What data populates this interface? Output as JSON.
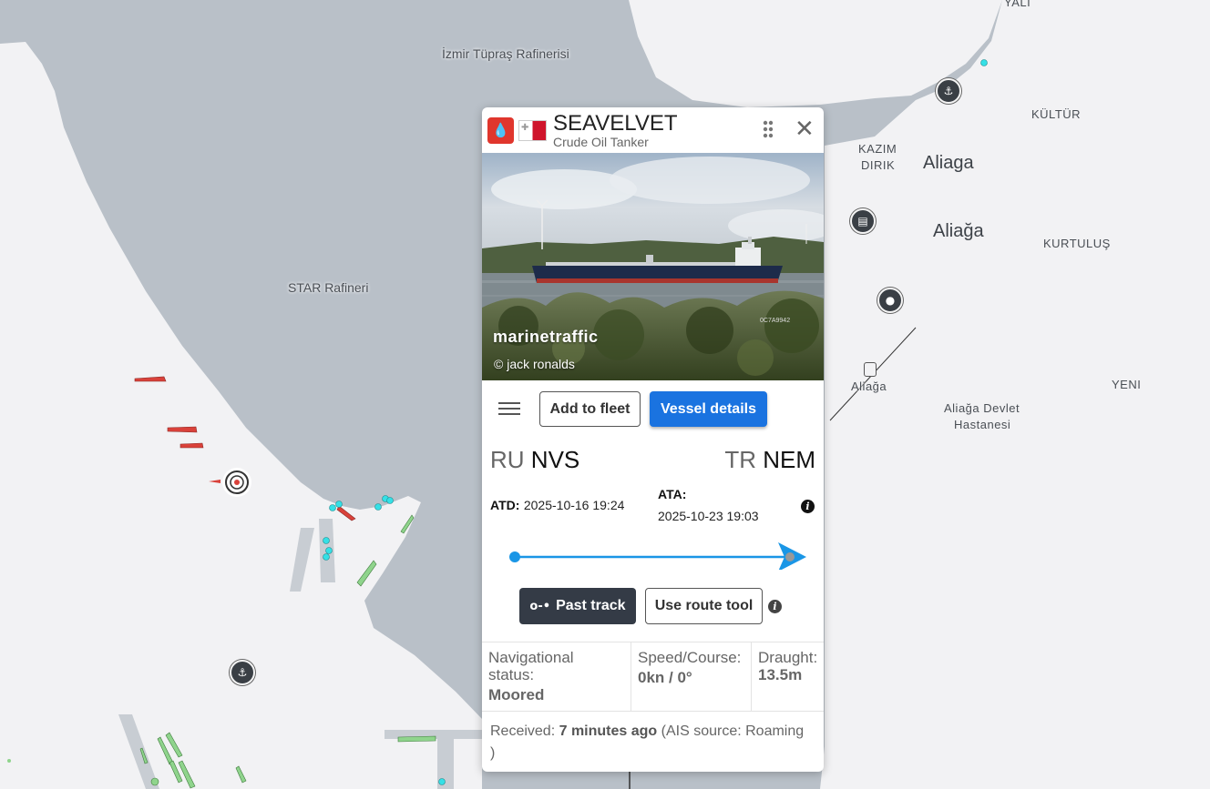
{
  "map": {
    "labels": {
      "izmir_tupras": "İzmir Tüpraş Rafinerisi",
      "star_rafineri": "STAR Rafineri",
      "yali": "YALI",
      "kultur": "KÜLTÜR",
      "kazim": "KAZIM",
      "dirik": "DIRIK",
      "aliaga_1": "Aliaga",
      "aliaga_2": "Aliağa",
      "kurtulus": "KURTULUŞ",
      "aliaga_station": "Aliağa",
      "yeni": "YENI",
      "hospital_1": "Aliağa Devlet",
      "hospital_2": "Hastanesi"
    },
    "colors": {
      "water": "#b9c0c8",
      "land": "#f2f2f4",
      "tanker": "#d9413a",
      "cargo": "#8fd48c",
      "passenger": "#35e0e6"
    }
  },
  "vessel": {
    "name": "SEAVELVET",
    "type": "Crude Oil Tanker",
    "type_icon": "oil-drop-icon",
    "flag": "Malta",
    "photo": {
      "watermark": "marinetraffic",
      "credit": "© jack ronalds",
      "photo_id": "0C7A9942"
    }
  },
  "actions": {
    "add_to_fleet": "Add to fleet",
    "vessel_details": "Vessel details",
    "past_track": "Past track",
    "route_tool": "Use route tool"
  },
  "voyage": {
    "departure_country": "RU",
    "departure_port": "NVS",
    "arrival_country": "TR",
    "arrival_port": "NEM",
    "atd_label": "ATD:",
    "atd_value": "2025-10-16 19:24",
    "ata_label": "ATA:",
    "ata_value": "2025-10-23 19:03",
    "progress": 1.0
  },
  "status": {
    "nav_label_1": "Navigational",
    "nav_label_2": "status:",
    "nav_value": "Moored",
    "speed_label": "Speed/Course:",
    "speed_value": "0kn / 0°",
    "draught_label": "Draught:",
    "draught_value": "13.5m"
  },
  "received": {
    "label": "Received:",
    "value": "7 minutes ago",
    "source_open": "(AIS source: Roaming",
    "source_close": ")"
  }
}
